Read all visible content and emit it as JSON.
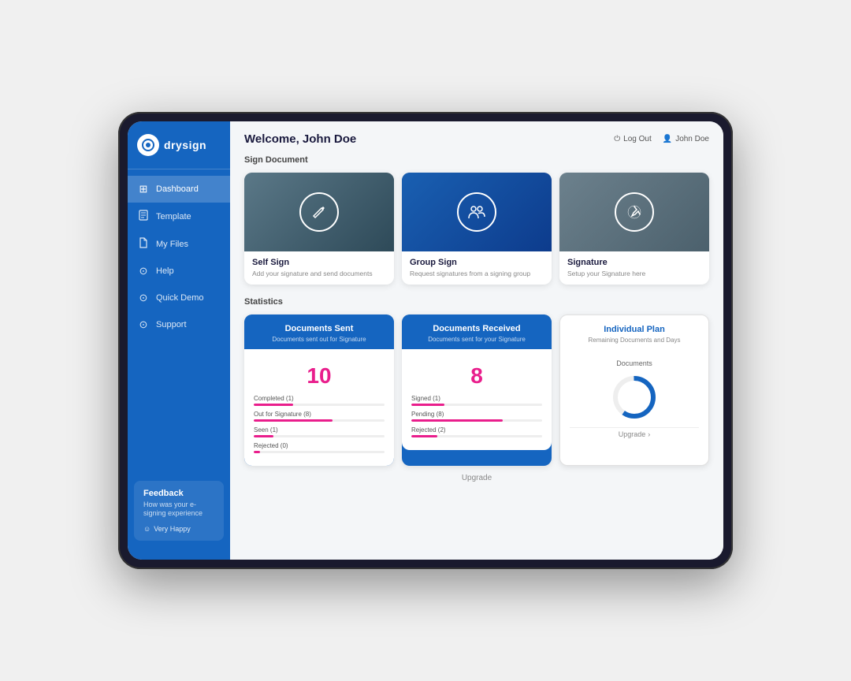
{
  "app": {
    "logo_text": "drysign",
    "logo_symbol": "◎"
  },
  "header": {
    "welcome": "Welcome, John Doe",
    "logout_label": "Log Out",
    "user_label": "John Doe"
  },
  "sidebar": {
    "items": [
      {
        "id": "dashboard",
        "label": "Dashboard",
        "icon": "⊞",
        "active": true
      },
      {
        "id": "template",
        "label": "Template",
        "icon": "📄",
        "active": false
      },
      {
        "id": "my-files",
        "label": "My Files",
        "icon": "📁",
        "active": false
      },
      {
        "id": "help",
        "label": "Help",
        "icon": "⊙",
        "active": false
      },
      {
        "id": "quick-demo",
        "label": "Quick Demo",
        "icon": "⊙",
        "active": false
      },
      {
        "id": "support",
        "label": "Support",
        "icon": "⊙",
        "active": false
      }
    ],
    "feedback": {
      "title": "Feedback",
      "subtitle": "How was your e-signing experience",
      "option": "Very Happy"
    }
  },
  "sign_document": {
    "section_title": "Sign Document",
    "cards": [
      {
        "id": "self-sign",
        "title": "Self Sign",
        "description": "Add your signature and send documents",
        "icon": "✏️",
        "type": "self-sign"
      },
      {
        "id": "group-sign",
        "title": "Group Sign",
        "description": "Request signatures from a signing group",
        "icon": "👥",
        "type": "group-sign"
      },
      {
        "id": "signature",
        "title": "Signature",
        "description": "Setup your Signature here",
        "icon": "✒️",
        "type": "signature"
      }
    ]
  },
  "statistics": {
    "section_title": "Statistics",
    "cards": [
      {
        "id": "docs-sent",
        "title": "Documents Sent",
        "subtitle": "Documents sent out for Signature",
        "number": "10",
        "rows": [
          {
            "label": "Completed (1)",
            "fill": 30,
            "type": "pink"
          },
          {
            "label": "Out for Signature (8)",
            "fill": 60,
            "type": "pink"
          },
          {
            "label": "Seen (1)",
            "fill": 15,
            "type": "pink"
          },
          {
            "label": "Rejected (0)",
            "fill": 5,
            "type": "pink"
          }
        ]
      },
      {
        "id": "docs-received",
        "title": "Documents Received",
        "subtitle": "Documents sent for your Signature",
        "number": "8",
        "rows": [
          {
            "label": "Signed (1)",
            "fill": 25,
            "type": "pink"
          },
          {
            "label": "Pending (8)",
            "fill": 70,
            "type": "pink"
          },
          {
            "label": "Rejected (2)",
            "fill": 20,
            "type": "pink"
          }
        ]
      },
      {
        "id": "individual-plan",
        "title": "Individual Plan",
        "subtitle": "Remaining Documents and Days",
        "plan_label": "Documents",
        "upgrade_label": "Upgrade"
      }
    ]
  }
}
